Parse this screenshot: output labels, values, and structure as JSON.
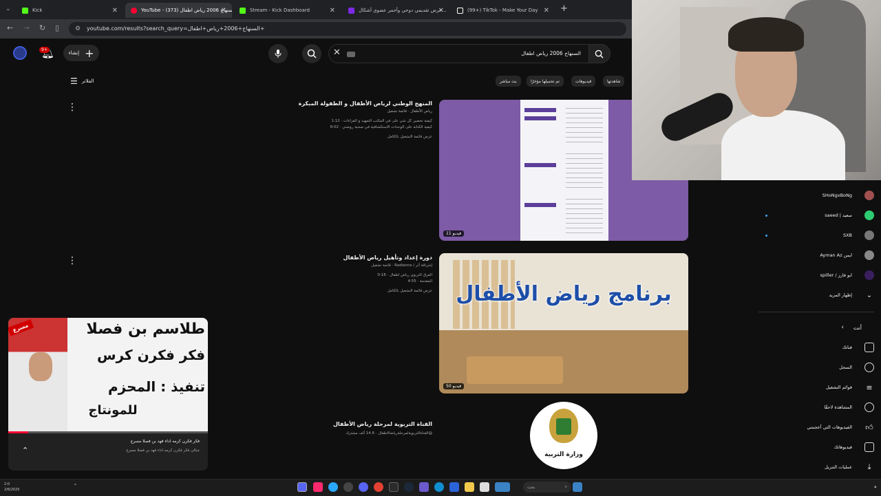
{
  "tabs": [
    {
      "label": "Kick",
      "color": "#53fc18"
    },
    {
      "label": "YouTube - السنهاج 2006 رياض اطفال (373)",
      "color": "#ff0033"
    },
    {
      "label": "Stream - Kick Dashboard",
      "color": "#53fc18"
    },
    {
      "label": "عرض تقديمي دوحي وأحمر عضوي أشكال...",
      "color": "#7d2ae8"
    },
    {
      "label": "(99+) TikTok - Make Your Day",
      "color": "#ffffff"
    }
  ],
  "new_tab": "+",
  "url": "youtube.com/results?search_query=السنهاج+2006+رياض+اطفال+",
  "header": {
    "create_label": "إنشاء",
    "notif_count": "9+",
    "search_value": "السنهاج 2006 رياض اطفال"
  },
  "filters": {
    "label": "الفلاتر",
    "chips": [
      "شاهدتها",
      "فيديوهات",
      "تم تحميلها مؤخرًا",
      "بث مباشر"
    ]
  },
  "results": [
    {
      "title": "المنهج الوطني لرياض الأطفال و الطفولة المبكرة",
      "channel": "رياض الأطفال · قائمة تشغيل",
      "line1": "كيفية تحضير كل شي على في المكتب التمهيد و القراءات · 1:12",
      "line2": "كيفية الكتابة على الوحدات الاستكشافية في صحبة روضتي · 8:02",
      "full": "عرض قائمة التشغيل بالكامل",
      "badge": "11 فيديو"
    },
    {
      "title": "دورة إعداد وتأهيل رياض الأطفال",
      "channel": "إشراقة أثر / Radiance · قائمة تشغيل",
      "line1": "الفرق التربوي رياض اطفال · 0:18",
      "line2": "المقدمة · 4:55",
      "full": "عرض قائمة التشغيل بالكامل",
      "badge": "50 فيديو",
      "thumb_text": "برنامج رياض الأطفال"
    },
    {
      "title": "القناة التربوية لمرحلة رياض الأطفال",
      "channel": "@القناةالتربويةلمرحلةرياضالاطفال · 14.6 ألف مشترك",
      "logo_text": "وزارة التربية"
    }
  ],
  "mini_player": {
    "line1": "طلاسم بن فصلا",
    "line2": "فكر فكرن كرس",
    "line3": "تنفيذ : المحزم",
    "line4": "للمونتاج",
    "ribbon": "مسرع",
    "caption1": "فكر فكرن كرمه اداء فهد بن فصلا مسرع",
    "caption2": "جبالي فكر فكرن كرمه اداء فهد بن فصلا مسرع"
  },
  "subscriptions": [
    {
      "name": "SHoNgxBoNg",
      "avatar_color": "#a05050"
    },
    {
      "name": "سعيد | saeed",
      "avatar_color": "#2ecc71"
    },
    {
      "name": "SXB",
      "avatar_color": "#777777"
    },
    {
      "name": "ايمن Ayman Az",
      "avatar_color": "#888888"
    },
    {
      "name": "ابو فارز / spiller",
      "avatar_color": "#3a1f5f"
    }
  ],
  "show_more": "إظهار المزيد",
  "you_section": {
    "header": "أنت",
    "items": [
      "قناتك",
      "السجل",
      "قوائم التشغيل",
      "المشاهدة لاحقًا",
      "الفيديوهات التي أعجبتني",
      "فيديوهاتك",
      "عمليات التنزيل"
    ]
  },
  "taskbar": {
    "time": "2:0",
    "date": "2/6/2025",
    "search": "بحث"
  },
  "colors": {
    "yt_red": "#ff0033",
    "kick_green": "#53fc18",
    "purple": "#7d5ba6"
  }
}
